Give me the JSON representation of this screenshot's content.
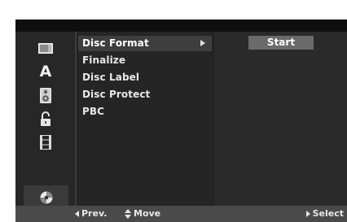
{
  "sidebar": {
    "icons": [
      {
        "name": "picture-icon"
      },
      {
        "name": "language-icon",
        "glyph": "A"
      },
      {
        "name": "audio-icon"
      },
      {
        "name": "lock-icon"
      },
      {
        "name": "recording-icon"
      },
      {
        "name": "disc-icon"
      }
    ],
    "active_index": 5
  },
  "options": {
    "items": [
      {
        "label": "Disc Format"
      },
      {
        "label": "Finalize"
      },
      {
        "label": "Disc Label"
      },
      {
        "label": "Disc Protect"
      },
      {
        "label": "PBC"
      }
    ],
    "selected_index": 0
  },
  "action": {
    "start_label": "Start"
  },
  "footer": {
    "prev_label": "Prev.",
    "move_label": "Move",
    "select_label": "Select"
  },
  "colors": {
    "panel": "#232323",
    "highlight": "#3e3e3e",
    "button": "#6a6a6a",
    "bar": "#4a4a4a",
    "text": "#e8e8e8"
  }
}
